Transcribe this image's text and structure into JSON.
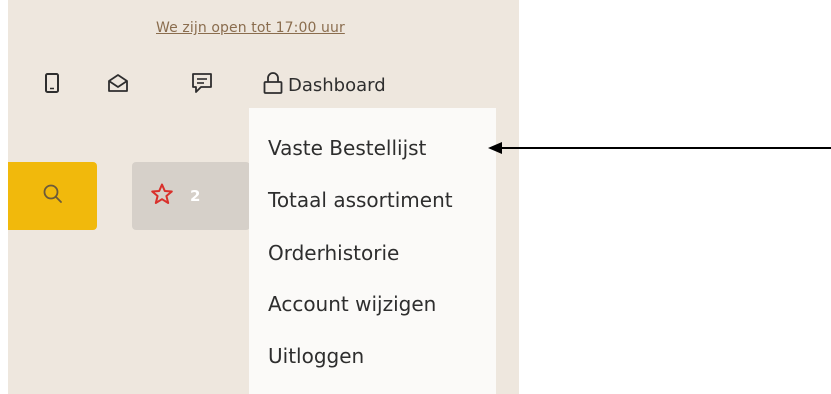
{
  "header": {
    "opening_hours_link": "We zijn open tot 17:00 uur",
    "icons": [
      "mobile-icon",
      "mail-icon",
      "chat-icon",
      "lock-icon"
    ],
    "dashboard_label": "Dashboard"
  },
  "toolbar": {
    "search_icon": "search-icon",
    "favorites_icon": "star-icon",
    "favorites_count": "2"
  },
  "dropdown": {
    "items": [
      {
        "label": "Vaste Bestellijst"
      },
      {
        "label": "Totaal assortiment"
      },
      {
        "label": "Orderhistorie"
      },
      {
        "label": "Account wijzigen"
      },
      {
        "label": "Uitloggen"
      }
    ]
  },
  "colors": {
    "panel_bg": "#eee7de",
    "search_button": "#f1b90c",
    "favorites_button": "#d6d0c9",
    "star": "#d9302b",
    "link": "#8a6d4e"
  }
}
